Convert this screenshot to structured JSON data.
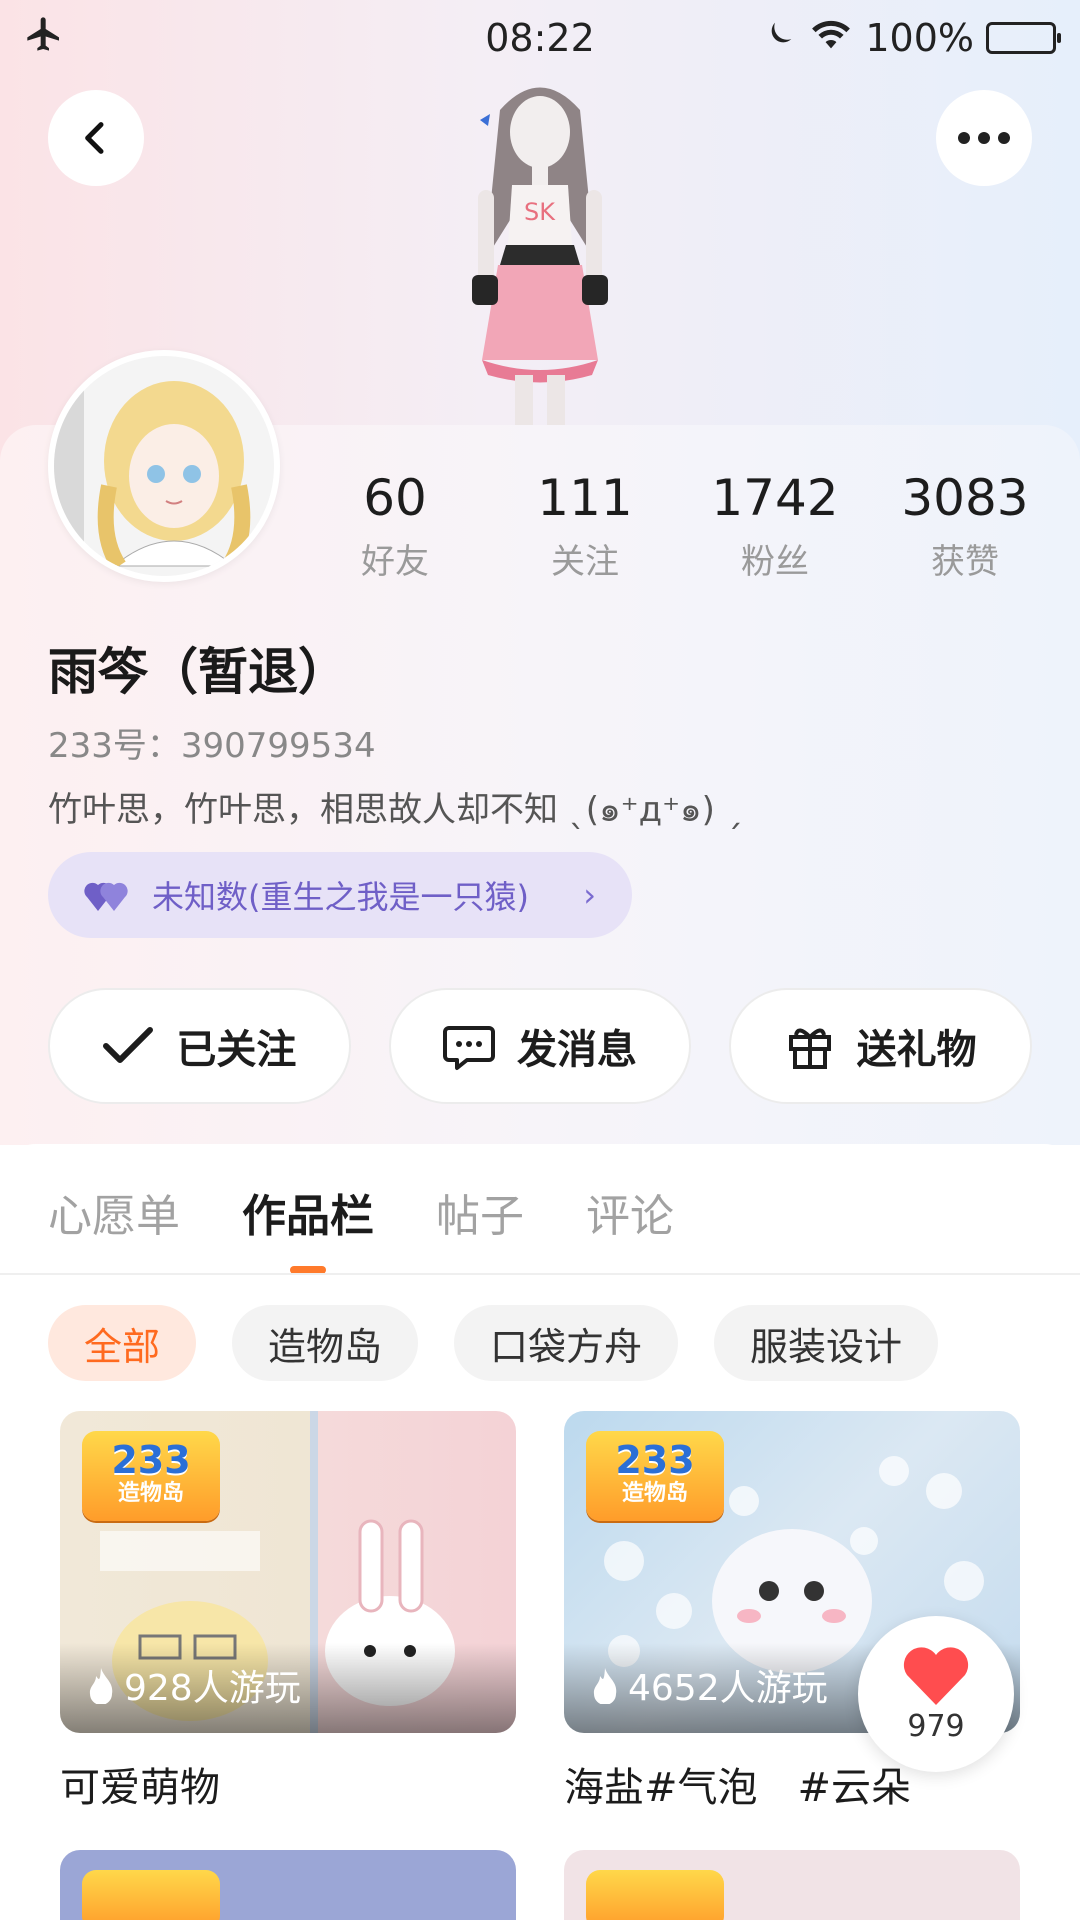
{
  "status_bar": {
    "time": "08:22",
    "battery": "100%"
  },
  "profile": {
    "name": "雨笒（暂退）",
    "uid": "233号：390799534",
    "bio": "竹叶思，竹叶思，相思故人却不知 ˎ(๑⁺д⁺๑) ˏ",
    "couple_label": "未知数(重生之我是一只猿)"
  },
  "stats": [
    {
      "value": "60",
      "label": "好友"
    },
    {
      "value": "111",
      "label": "关注"
    },
    {
      "value": "1742",
      "label": "粉丝"
    },
    {
      "value": "3083",
      "label": "获赞"
    }
  ],
  "actions": {
    "follow": "已关注",
    "message": "发消息",
    "gift": "送礼物"
  },
  "tabs": [
    {
      "label": "心愿单"
    },
    {
      "label": "作品栏",
      "active": true
    },
    {
      "label": "帖子"
    },
    {
      "label": "评论"
    }
  ],
  "filters": [
    {
      "label": "全部",
      "active": true
    },
    {
      "label": "造物岛"
    },
    {
      "label": "口袋方舟"
    },
    {
      "label": "服装设计"
    }
  ],
  "works": [
    {
      "title": "可爱萌物",
      "plays": "928人游玩",
      "logo_num": "233",
      "logo_text": "造物岛"
    },
    {
      "title": "海盐#气泡　#云朵",
      "plays": "4652人游玩",
      "logo_num": "233",
      "logo_text": "造物岛"
    }
  ],
  "like_bubble": {
    "count": "979"
  },
  "colors": {
    "accent": "#ff7a2b",
    "couple_bg": "#e7e2f7",
    "couple_text": "#6f5fc7",
    "like": "#ff4d4f"
  }
}
